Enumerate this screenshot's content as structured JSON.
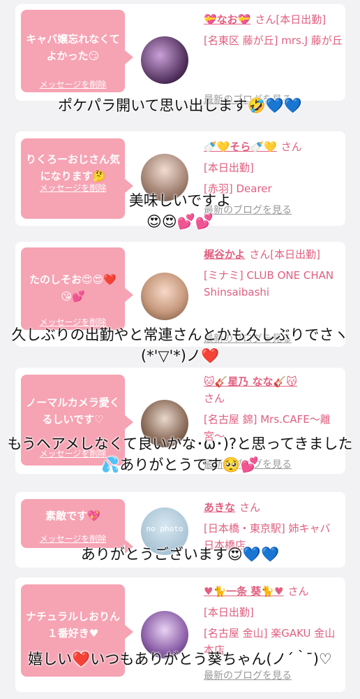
{
  "cards": [
    {
      "message": "キャバ嬢忘れなくてよかった😏",
      "delete_label": "メッセージを削除",
      "name": "💝なお💝",
      "info": "さん[本日出勤]",
      "shop": "[名東区 藤が丘] mrs.J 藤が丘",
      "blog_label": "最新のブログを見る",
      "reply": "ポケパラ開いて思い出します🤣💙💙"
    },
    {
      "message": "りくろーおじさん気になります🤔",
      "delete_label": "メッセージを削除",
      "name": "🍼💛そら🍼💛",
      "info": "さん",
      "status": "[本日出勤]",
      "shop": "[赤羽] Dearer",
      "blog_label": "最新のブログを見る",
      "reply": "美味しいですよ\n😍😍💕💕"
    },
    {
      "message": "たのしそお😍😍❤️😘💕",
      "delete_label": "メッセージを削除",
      "name": "梶谷かよ",
      "info": "さん[本日出勤]",
      "shop": "[ミナミ] CLUB ONE CHAN Shinsaibashi",
      "blog_label": "最新のブログを見る",
      "reply": "久しぶりの出勤やと常連さんとかも久しぶりでさヽ(*'▽'*)ノ❤️"
    },
    {
      "message": "ノーマルカメラ愛くるしいです♡",
      "delete_label": "メッセージを削除",
      "name": "🐱🎸星乃 なな🎸😽",
      "info": "さん",
      "shop": "[名古屋 錦] Mrs.CAFE〜離宮〜",
      "blog_label": "最新のブログを見る",
      "reply": "もうヘアメしなくて良いかな･ω･)?と思ってきました💦ありがとうです🥺💕"
    },
    {
      "message": "素敵です💖",
      "delete_label": "メッセージを削除",
      "avatar_text": "no photo",
      "name": "あきな",
      "info": "さん",
      "shop": "[日本橋・東京駅] 姉キャバ 日本橋店",
      "blog_label": "最新のブログを見る",
      "reply": "ありがとうございます😍💙💙"
    },
    {
      "message": "ナチュラルしおりん１番好き♥",
      "delete_label": "メッセージを削除",
      "name": "♥🐈一条 葵🐈♥",
      "info": "さん",
      "status": "[本日出勤]",
      "shop": "[名古屋 金山] 楽GAKU 金山本店",
      "blog_label": "最新のブログを見る",
      "reply": "嬉しい❤️いつもありがとう葵ちゃん(ノ´｀ ̄)♡"
    }
  ],
  "colors": {
    "bubble": "#f6a3b3",
    "name": "#e05f7f",
    "background": "#f2f2f4"
  }
}
